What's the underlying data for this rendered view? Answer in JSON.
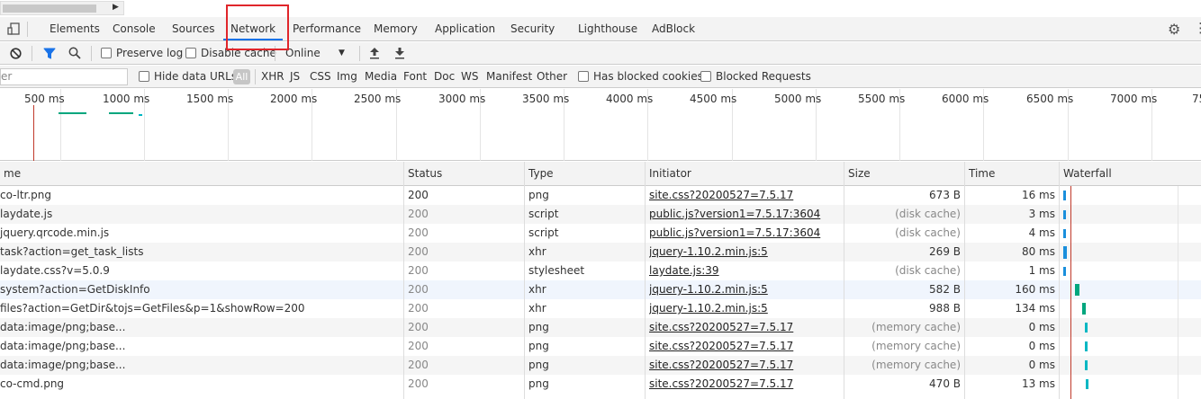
{
  "tabs": [
    {
      "label": "Elements"
    },
    {
      "label": "Console"
    },
    {
      "label": "Sources"
    },
    {
      "label": "Network"
    },
    {
      "label": "Performance"
    },
    {
      "label": "Memory"
    },
    {
      "label": "Application"
    },
    {
      "label": "Security"
    },
    {
      "label": "Lighthouse"
    },
    {
      "label": "AdBlock"
    }
  ],
  "toolbar": {
    "preserve_log": "Preserve log",
    "disable_cache": "Disable cache",
    "throttle": "Online"
  },
  "filter": {
    "placeholder": "er",
    "hide_data_urls": "Hide data URLs",
    "all": "All",
    "types": [
      "XHR",
      "JS",
      "CSS",
      "Img",
      "Media",
      "Font",
      "Doc",
      "WS",
      "Manifest",
      "Other"
    ],
    "has_blocked_cookies": "Has blocked cookies",
    "blocked_requests": "Blocked Requests"
  },
  "overview": {
    "ticks": [
      "500 ms",
      "1000 ms",
      "1500 ms",
      "2000 ms",
      "2500 ms",
      "3000 ms",
      "3500 ms",
      "4000 ms",
      "4500 ms",
      "5000 ms",
      "5500 ms",
      "6000 ms",
      "6500 ms",
      "7000 ms",
      "75"
    ]
  },
  "table": {
    "headers": {
      "name": "me",
      "status": "Status",
      "type": "Type",
      "initiator": "Initiator",
      "size": "Size",
      "time": "Time",
      "waterfall": "Waterfall"
    },
    "rows": [
      {
        "name": "co-ltr.png",
        "status": "200",
        "type": "png",
        "initiator": "site.css?20200527=7.5.17",
        "size": "673 B",
        "time": "16 ms"
      },
      {
        "name": "laydate.js",
        "status": "200",
        "type": "script",
        "initiator": "public.js?version1=7.5.17:3604",
        "size": "(disk cache)",
        "time": "3 ms"
      },
      {
        "name": "jquery.qrcode.min.js",
        "status": "200",
        "type": "script",
        "initiator": "public.js?version1=7.5.17:3604",
        "size": "(disk cache)",
        "time": "4 ms"
      },
      {
        "name": "task?action=get_task_lists",
        "status": "200",
        "type": "xhr",
        "initiator": "jquery-1.10.2.min.js:5",
        "size": "269 B",
        "time": "80 ms"
      },
      {
        "name": "laydate.css?v=5.0.9",
        "status": "200",
        "type": "stylesheet",
        "initiator": "laydate.js:39",
        "size": "(disk cache)",
        "time": "1 ms"
      },
      {
        "name": "system?action=GetDiskInfo",
        "status": "200",
        "type": "xhr",
        "initiator": "jquery-1.10.2.min.js:5",
        "size": "582 B",
        "time": "160 ms"
      },
      {
        "name": "files?action=GetDir&tojs=GetFiles&p=1&showRow=200",
        "status": "200",
        "type": "xhr",
        "initiator": "jquery-1.10.2.min.js:5",
        "size": "988 B",
        "time": "134 ms"
      },
      {
        "name": "data:image/png;base...",
        "status": "200",
        "type": "png",
        "initiator": "site.css?20200527=7.5.17",
        "size": "(memory cache)",
        "time": "0 ms"
      },
      {
        "name": "data:image/png;base...",
        "status": "200",
        "type": "png",
        "initiator": "site.css?20200527=7.5.17",
        "size": "(memory cache)",
        "time": "0 ms"
      },
      {
        "name": "data:image/png;base...",
        "status": "200",
        "type": "png",
        "initiator": "site.css?20200527=7.5.17",
        "size": "(memory cache)",
        "time": "0 ms"
      },
      {
        "name": "co-cmd.png",
        "status": "200",
        "type": "png",
        "initiator": "site.css?20200527=7.5.17",
        "size": "470 B",
        "time": "13 ms"
      }
    ]
  },
  "colors": {
    "accent": "#1a73e8",
    "highlight_box": "#e0262b",
    "waterfall_blue": "#1a8fdc",
    "waterfall_green": "#00a67e",
    "waterfall_teal": "#00b7c3"
  }
}
